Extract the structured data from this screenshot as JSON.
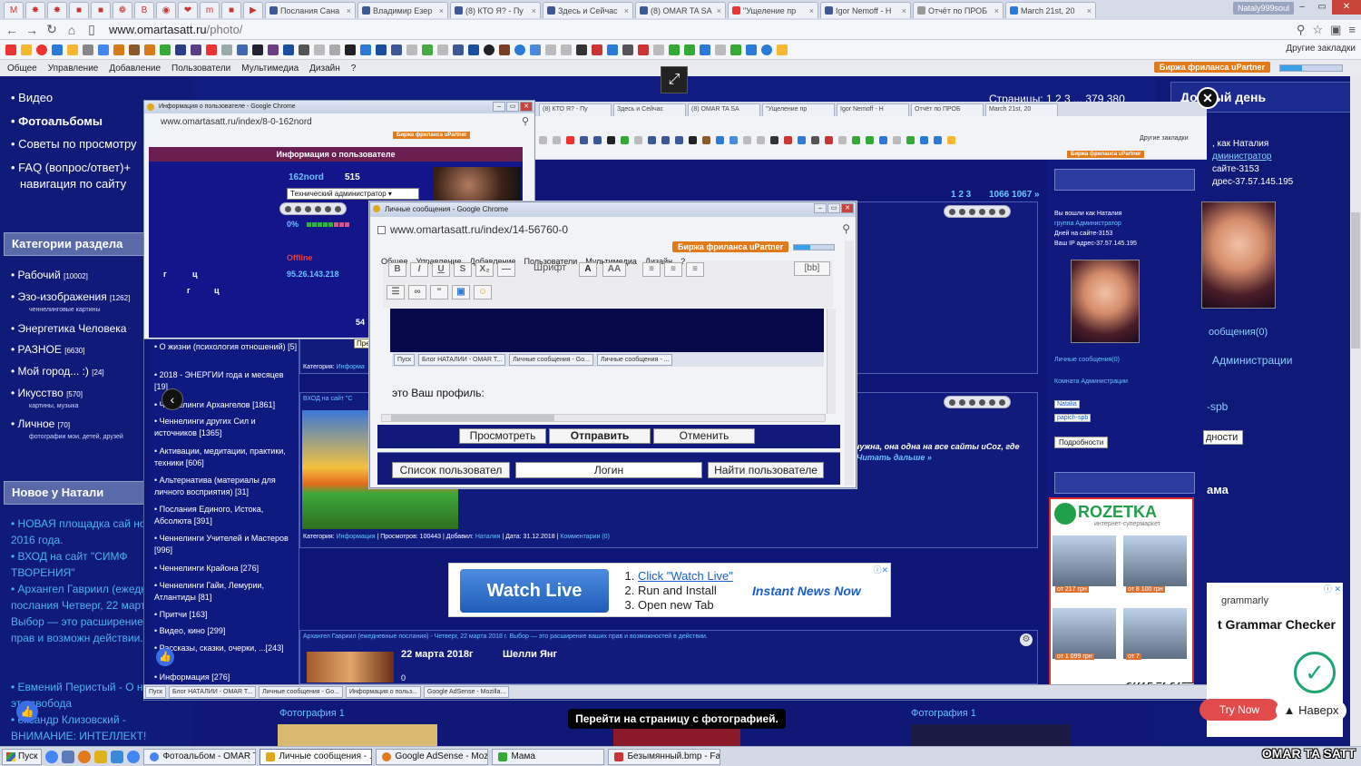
{
  "browser": {
    "tabs": [
      "Послания Сана",
      "Владимир Езер",
      "(8) КТО Я? - Пу",
      "Здесь и Сейчас",
      "(8) OMAR TA SA",
      "\"Ущеление пр",
      "Igor Nemoff - H",
      "Отчёт по ПРОБ",
      "March 21st, 20"
    ],
    "user_badge": "Nataly999soul",
    "url_host": "www.omartasatt.ru",
    "url_path": "/photo/",
    "other_bookmarks": "Другие закладки",
    "freelance_badge": "Биржа фриланса uPartner"
  },
  "site_menu": [
    "Общее",
    "Управление",
    "Добавление",
    "Пользователи",
    "Мультимедиа",
    "Дизайн",
    "?"
  ],
  "left": {
    "top_items": [
      "Видео",
      "Фотоальбомы",
      "Советы по просмотру",
      "FAQ (вопрос/ответ)+",
      "навигация по сайту"
    ],
    "categories_title": "Категории раздела",
    "categories": [
      {
        "name": "Рабочий",
        "count": "[10002]",
        "sub": ""
      },
      {
        "name": "Эзо-изображения",
        "count": "[1262]",
        "sub": "ченнелинговые картины"
      },
      {
        "name": "Энергетика Человека",
        "count": "",
        "sub": ""
      },
      {
        "name": "РАЗНОЕ",
        "count": "[6630]",
        "sub": ""
      },
      {
        "name": "Мой город... :)",
        "count": "[24]",
        "sub": ""
      },
      {
        "name": "Икусство",
        "count": "[570]",
        "sub": "картины, музыка"
      },
      {
        "name": "Личное",
        "count": "[70]",
        "sub": "фотографии мои, детей, друзей"
      }
    ],
    "news_title": "Новое у Натали",
    "news": [
      "НОВАЯ площадка сай ноября 2016 года.",
      "ВХОД на сайт \"СИМФ ТВОРЕНИЯ\"",
      "Архангел Гавриил (ежедневные послания Четверг, 22 марта 2018 Выбор — это расширение ваших прав и возможн действии.",
      "Евмений Перистый - О нанность - это свобода",
      "ександр Клизовский - ВНИМАНИЕ: ИНТЕЛЛЕКТ!"
    ]
  },
  "main": {
    "pager_top": "Страницы: 1 2 3 ... 379 380",
    "pager_inner": "1 2 3",
    "pager_inner2": "1066 1067 »",
    "post1_cat_label": "Категория:",
    "post1_cat": "Информа",
    "post2_head": "ВХОД на сайт \"С",
    "post2_text": "нужна, она одна на все сайты uCoz, где",
    "post2_more": "Читать дальше »",
    "post2_meta": {
      "cat_label": "Категория:",
      "cat": "Информация",
      "views": "Просмотров: 100443",
      "added_label": "Добавил:",
      "added": "Наталия",
      "date": "Дата: 31.12.2018",
      "comments": "Комментарии (0)"
    },
    "post3_head": "Архангел Гавриил (ежедневные послания) - Четверг, 22 марта 2018 г. Выбор — это расширение ваших прав и возможностей в действии.",
    "post3_date": "22 марта 2018г",
    "post3_author": "Шелли Янг",
    "post3_zero": "0",
    "photo_label_left": "Фотография 1",
    "photo_label_right": "Фотография 1",
    "tooltip": "Перейти на страницу с фотографией."
  },
  "ad": {
    "button": "Watch Live",
    "steps": [
      "Click \"Watch Live\"",
      "Run and Install",
      "Open new Tab"
    ],
    "brand": "Instant News Now",
    "adchoice": "ⓘ✕"
  },
  "right": {
    "title": "Добрый день",
    "login_lines": [
      "Вы вошли как Наталия",
      "группа Администратор",
      "Дней на сайте-3153",
      "Ваш IP адрес-37.57.145.195"
    ],
    "pm": "Личные сообщения(0)",
    "admin_room": "Комната Администрации",
    "link_natalia": "Natalia",
    "link_papich": "papich-spb",
    "more_btn": "Подробности",
    "mama": "Мама",
    "right_pm": "ообщения(0)",
    "right_admin": "Администрации",
    "right_login": ", как Наталия",
    "right_group": "дминистратор",
    "right_days": "сайте-3153",
    "right_ip": "дрес-37.57.145.195",
    "right_more": "дности",
    "right_spb": "-spb",
    "right_mama": "ама"
  },
  "rozetka": {
    "logo": "ROZETKA",
    "sub": "интернет-супермаркет",
    "prices": [
      "от 217 грн",
      "от 8 100 грн",
      "от 1 099 грн",
      "от 7"
    ]
  },
  "grammarly": {
    "logo": "grammarly",
    "title": "t Grammar Checker",
    "try": "Try Now",
    "close": "ⓘ ✕"
  },
  "naverh": "▲ Наверх",
  "watermark": "OMAR TA SATT",
  "user_window": {
    "title": "Информация о пользователе - Google Chrome",
    "url": "www.omartasatt.ru/index/8-0-162nord",
    "header": "Информация о пользователе",
    "name": "162nord",
    "number": "515",
    "role": "Технический администратор ▾",
    "pct": "0%",
    "offline": "Offline",
    "ip": "95.26.143.218",
    "count": "54",
    "g1": "г",
    "c1": "ц",
    "g2": "г",
    "c2": "ц",
    "prev_tip": "Предыдущий"
  },
  "subcats": [
    "О жизни (психология отношений) [5]",
    "2018 - ЭНЕРГИИ года и месяцев [19]",
    "Ченнелинги Архангелов [1861]",
    "Ченнелинги других Сил и источников [1365]",
    "Активации, медитации, практики, техники [606]",
    "Альтернатива (материалы для личного восприятия) [31]",
    "Послания Единого, Истока, Абсолюта [391]",
    "Ченнелинги Учителей и Мастеров [996]",
    "Ченнелинги Крайона [276]",
    "Ченнелинги Гайи, Лемурии, Атлантиды [81]",
    "Притчи [163]",
    "Видео, кино [299]",
    "Рассказы, сказки, очерки, ...[243]",
    "Информация [276]"
  ],
  "pm_window": {
    "title": "Личные сообщения - Google Chrome",
    "url": "www.omartasatt.ru/index/14-56760-0",
    "freelance": "Биржа фриланса uPartner",
    "menu": [
      "Общее",
      "Управление",
      "Добавление",
      "Пользователи",
      "Мультимедиа",
      "Дизайн",
      "?"
    ],
    "font_label": "Шрифт",
    "bb": "[bb]",
    "taskbar": [
      "Пуск",
      "Блог НАТАЛИИ - OMAR T...",
      "Личные сообщения - Go...",
      "Личные сообщения - ..."
    ],
    "profile_text": "это Ваш профиль:",
    "preview_btn": "Просмотреть",
    "send_btn": "Отправить",
    "cancel_btn": "Отменить",
    "user_list_btn": "Список пользовател",
    "login_field": "Логин",
    "find_btn": "Найти пользователе"
  },
  "inner_taskbar": [
    "Пуск",
    "Блог НАТАЛИИ - OMAR T...",
    "Личные сообщения - Go...",
    "Информация о польз...",
    "Google AdSense - Mozilla..."
  ],
  "taskbar": {
    "start": "Пуск",
    "tasks": [
      "Фотоальбом - OMAR TA ...",
      "Личные сообщения - ...",
      "Google AdSense - Mozilla...",
      "Мама",
      "Безымянный.bmp - Fas..."
    ]
  },
  "colors": {
    "page_bg": "#0d1569",
    "accent_link": "#4cb3f0",
    "freelance": "#e07a1a",
    "header_purple": "#6a1f50"
  }
}
